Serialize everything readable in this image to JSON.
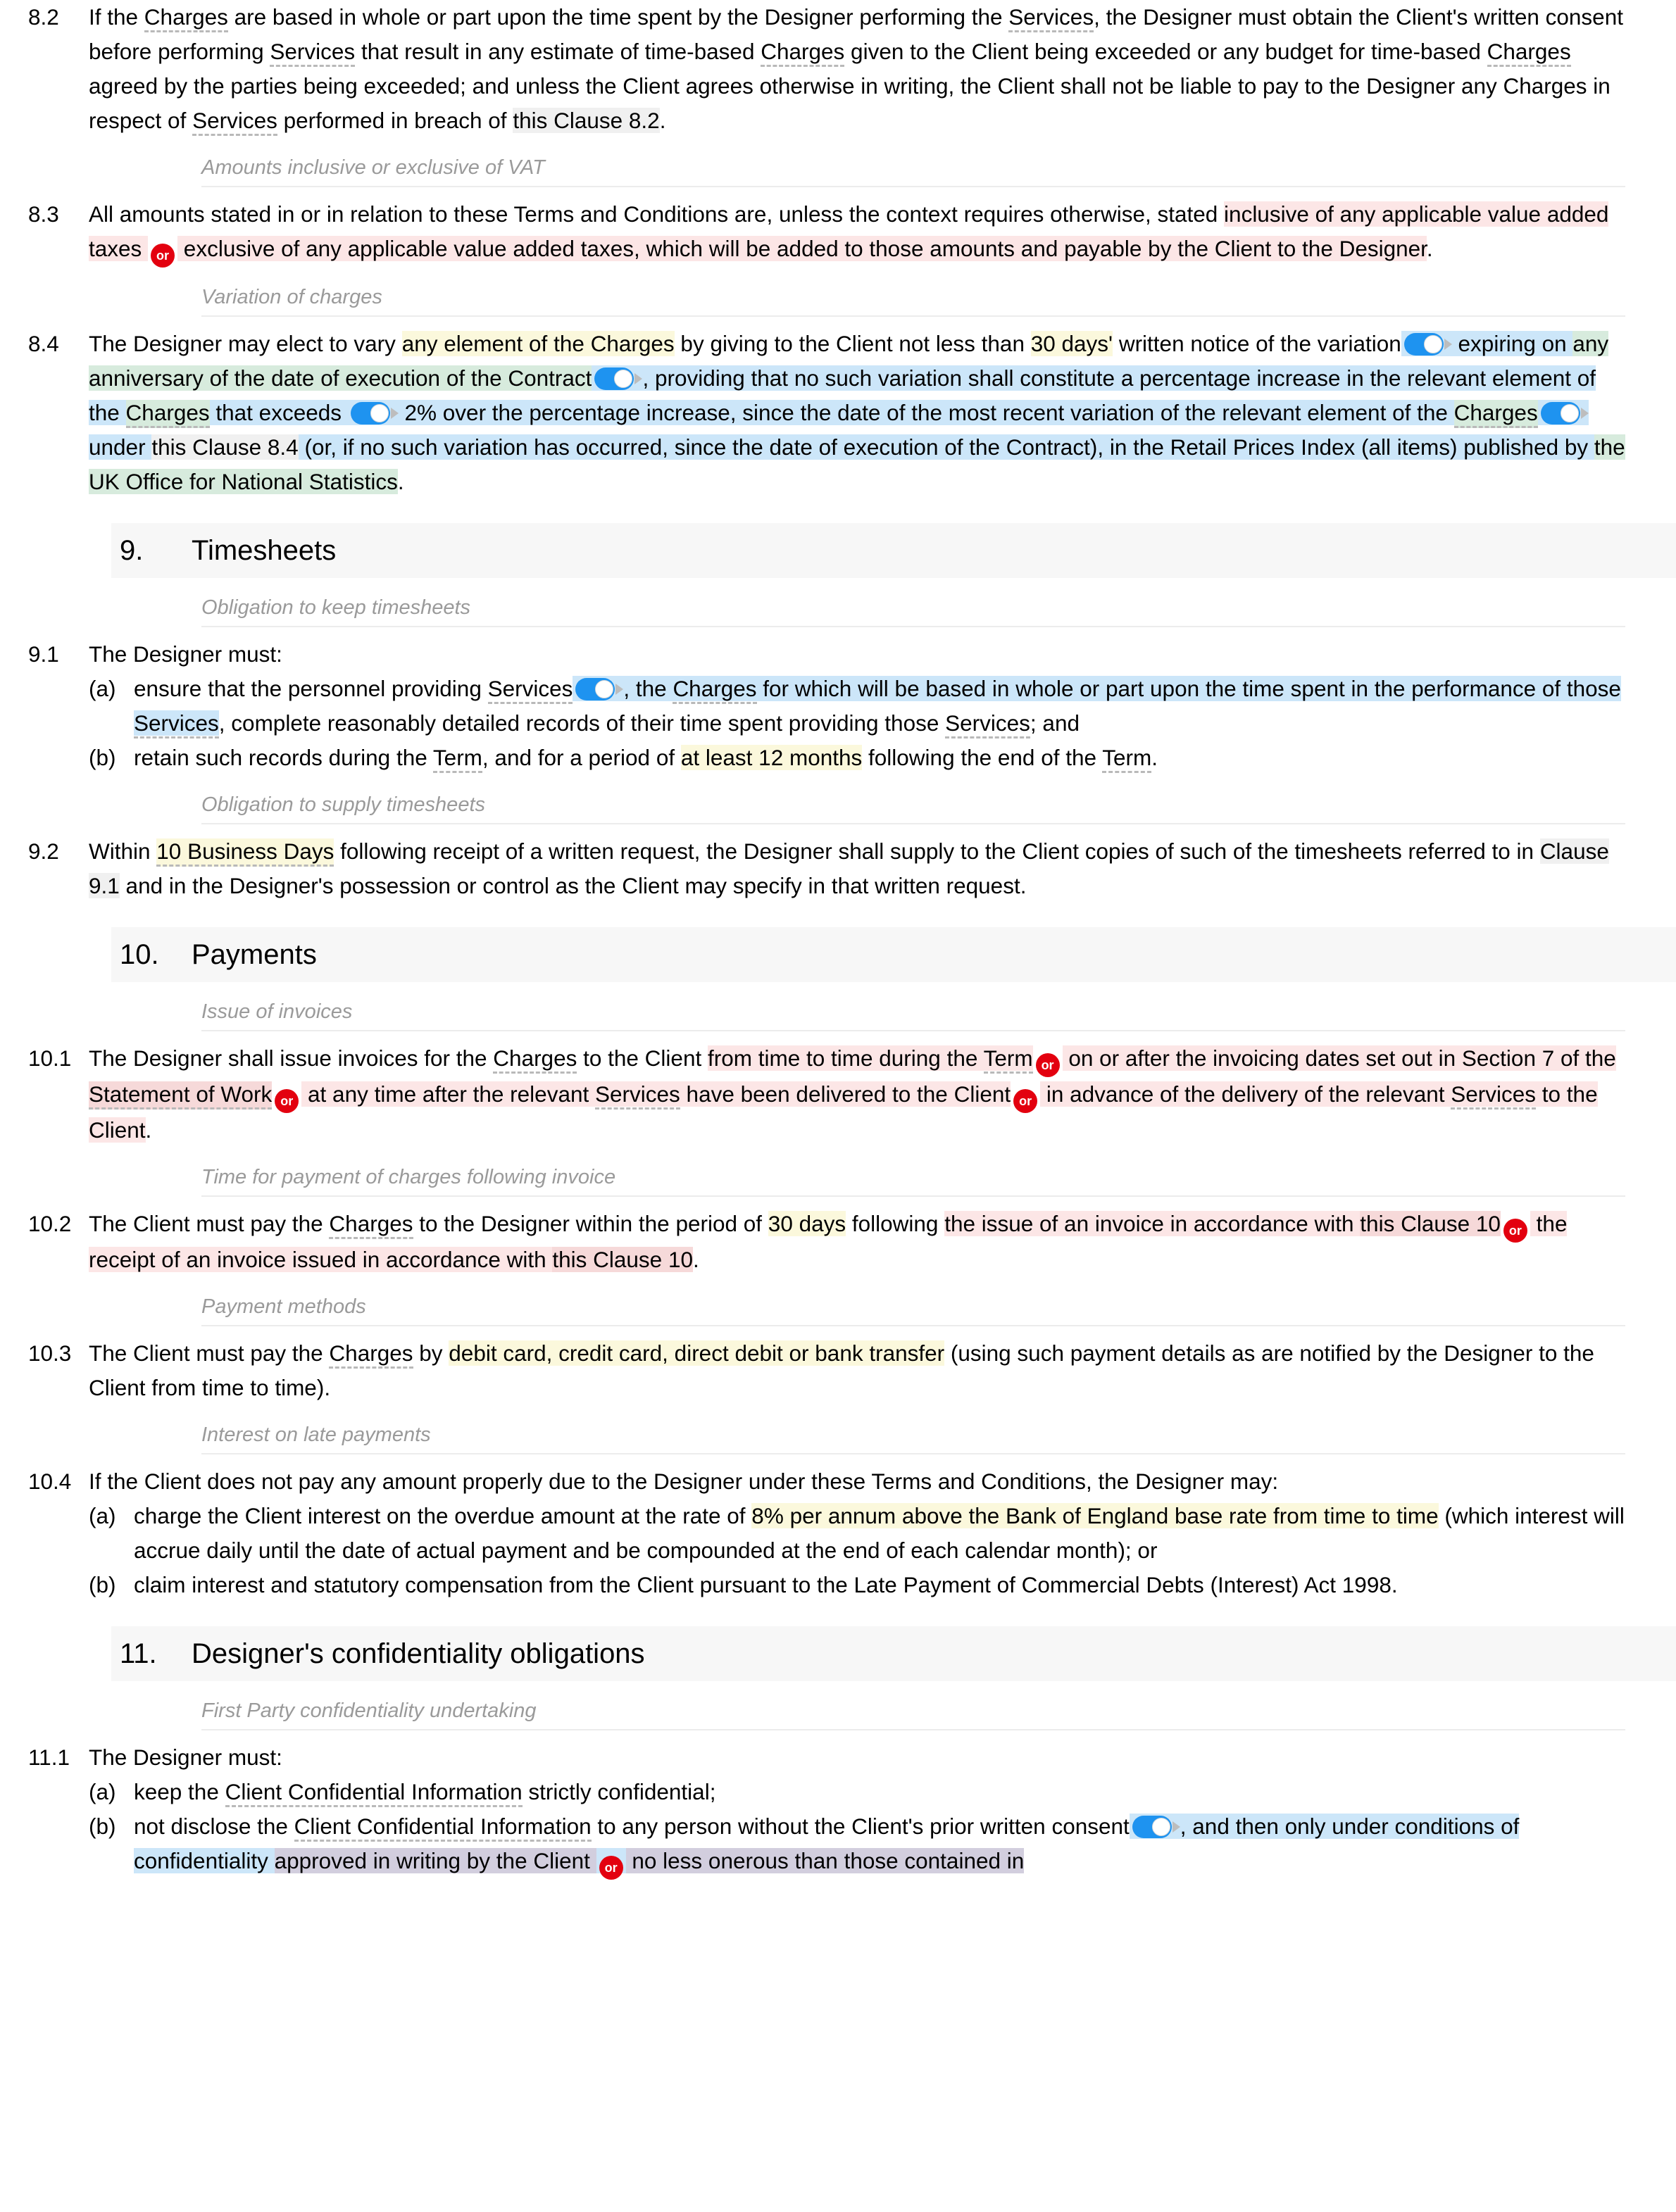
{
  "colors": {
    "highlight_pink": "#fce6e6",
    "highlight_pink_overlap": "#f6d9d9",
    "highlight_yellow": "#fbf8dc",
    "highlight_blue": "#cce6f9",
    "highlight_green": "#d7ebdd",
    "highlight_purple_overlap": "#d2cede",
    "badge_red": "#e3000f",
    "toggle_blue": "#1e93f0",
    "section_band": "#f7f7f7",
    "subheading_grey": "#9a9a9a"
  },
  "badges": {
    "or_label": "or"
  },
  "clauses": {
    "c8_2": {
      "number": "8.2",
      "t1": "If the ",
      "term1": "Charges",
      "t2": " are based in whole or part upon the time spent by the Designer performing the ",
      "term2": "Services",
      "t3": ", the Designer must obtain the Client's written consent before performing ",
      "term3": "Services",
      "t4": " that result in any estimate of time-based ",
      "term4": "Charges",
      "t5": " given to the Client being exceeded or any budget for time-based ",
      "term5": "Charges",
      "t6": " agreed by the parties being exceeded; and unless the Client agrees otherwise in writing, the Client shall not be liable to pay to the Designer any Charges in respect of ",
      "term6": "Services",
      "t7": " performed in breach of ",
      "xref": "this Clause 8.2",
      "t8": "."
    },
    "sub_vat": {
      "title": "Amounts inclusive or exclusive of VAT"
    },
    "c8_3": {
      "number": "8.3",
      "t1": "All amounts stated in or in relation to these Terms and Conditions are, unless the context requires otherwise, stated ",
      "hl1": "inclusive of any applicable value added taxes ",
      "hl2": " exclusive of any applicable value added taxes, which will be added to those amounts and payable by the Client to the Designer",
      "t2": "."
    },
    "sub_variation": {
      "title": "Variation of charges"
    },
    "c8_4": {
      "number": "8.4",
      "t1": "The Designer may elect to vary ",
      "hl_y1": "any element of the Charges",
      "t2": " by giving to the Client not less than ",
      "hl_y2": "30 days'",
      "t3": " written notice of the variation",
      "hl_b1": " expiring on ",
      "hl_g1": "any anniversary of the date of execution of the Contract",
      "hl_b2": ", providing that no such variation shall constitute a percentage increase in the relevant element of the ",
      "hl_g2": "Charges",
      "hl_b3": " that exceeds ",
      "hl_b4": " 2% over the percentage increase, since the date of the most recent variation of the relevant element of the ",
      "hl_g3": "Charges",
      "hl_b5": " under ",
      "hl_b5x": "this Clause 8.4",
      "hl_b6": " (or, if no such variation has occurred, since the date of execution of the Contract), in the Retail Prices Index (all items) published by ",
      "hl_g4": "the UK Office for National Statistics",
      "t4": "."
    }
  },
  "sections": {
    "s9": {
      "number": "9.",
      "title": "Timesheets"
    },
    "s10": {
      "number": "10.",
      "title": "Payments"
    },
    "s11": {
      "number": "11.",
      "title": "Designer's confidentiality obligations"
    }
  },
  "section9": {
    "sub_keep": {
      "title": "Obligation to keep timesheets"
    },
    "c9_1": {
      "number": "9.1",
      "lead": "The Designer must:",
      "a_label": "(a)",
      "a_t1": "ensure that the personnel providing ",
      "a_term1": "Services",
      "a_hl1": ", the ",
      "a_hl_term": "Charges",
      "a_hl2": " for which will be based in whole or part upon the time spent in the performance of those ",
      "a_hl_term2": "Services",
      "a_t2": ", complete reasonably detailed records of their time spent providing those ",
      "a_term3": "Services",
      "a_t3": "; and",
      "b_label": "(b)",
      "b_t1": "retain such records during the ",
      "b_term1": "Term",
      "b_t2": ", and for a period of ",
      "b_hl": "at least 12 months",
      "b_t3": " following the end of the ",
      "b_term2": "Term",
      "b_t4": "."
    },
    "sub_supply": {
      "title": "Obligation to supply timesheets"
    },
    "c9_2": {
      "number": "9.2",
      "t1": "Within ",
      "hl1": "10 Business Days",
      "t2": " following receipt of a written request, the Designer shall supply to the Client copies of such of the timesheets referred to in ",
      "xref": "Clause 9.1",
      "t3": " and in the Designer's possession or control as the Client may specify in that written request."
    }
  },
  "section10": {
    "sub_invoices": {
      "title": "Issue of invoices"
    },
    "c10_1": {
      "number": "10.1",
      "t1": "The Designer shall issue invoices for the ",
      "term1": "Charges",
      "t2": " to the Client ",
      "hl1": "from time to time during the ",
      "hl1_term": "Term",
      "hl2": " on or after the invoicing dates set out in Section 7 of the ",
      "hl2_term": "Statement of Work",
      "hl3": " at any time after the relevant ",
      "hl3_term": "Services",
      "hl3b": " have been delivered to the Client",
      "hl4": " in advance of the delivery of the relevant ",
      "hl4_term": "Services",
      "hl4b": " to the Client",
      "t3": "."
    },
    "sub_time": {
      "title": "Time for payment of charges following invoice"
    },
    "c10_2": {
      "number": "10.2",
      "t1": "The Client must pay the ",
      "term1": "Charges",
      "t2": " to the Designer within the period of ",
      "hl_y": "30 days",
      "t3": " following ",
      "hl1": "the issue of an invoice in accordance with ",
      "hl1x": "this Clause 10",
      "hl2": " the receipt of an invoice issued in accordance with ",
      "hl2x": "this Clause 10",
      "t4": "."
    },
    "sub_methods": {
      "title": "Payment methods"
    },
    "c10_3": {
      "number": "10.3",
      "t1": "The Client must pay the ",
      "term1": "Charges",
      "t2": " by ",
      "hl": "debit card, credit card, direct debit or bank transfer",
      "t3": " (using such payment details as are notified by the Designer to the Client from time to time)."
    },
    "sub_interest": {
      "title": "Interest on late payments"
    },
    "c10_4": {
      "number": "10.4",
      "lead": "If the Client does not pay any amount properly due to the Designer under these Terms and Conditions, the Designer may:",
      "a_label": "(a)",
      "a_t1": "charge the Client interest on the overdue amount at the rate of ",
      "a_hl": "8% per annum above the Bank of England base rate from time to time",
      "a_t2": " (which interest will accrue daily until the date of actual payment and be compounded at the end of each calendar month); or",
      "b_label": "(b)",
      "b_t1": "claim interest and statutory compensation from the Client pursuant to the Late Payment of Commercial Debts (Interest) Act 1998."
    }
  },
  "section11": {
    "sub_first_party": {
      "title": "First Party confidentiality undertaking"
    },
    "c11_1": {
      "number": "11.1",
      "lead": "The Designer must:",
      "a_label": "(a)",
      "a_t1": "keep the ",
      "a_term": "Client Confidential Information",
      "a_t2": " strictly confidential;",
      "b_label": "(b)",
      "b_t1": "not disclose the ",
      "b_term": "Client Confidential Information",
      "b_t2": " to any person without the Client's prior written consent",
      "b_hl1": ", and then only under conditions of confidentiality ",
      "b_hl2": "approved in writing by the Client ",
      "b_hl3": " no less onerous than those contained in"
    }
  }
}
